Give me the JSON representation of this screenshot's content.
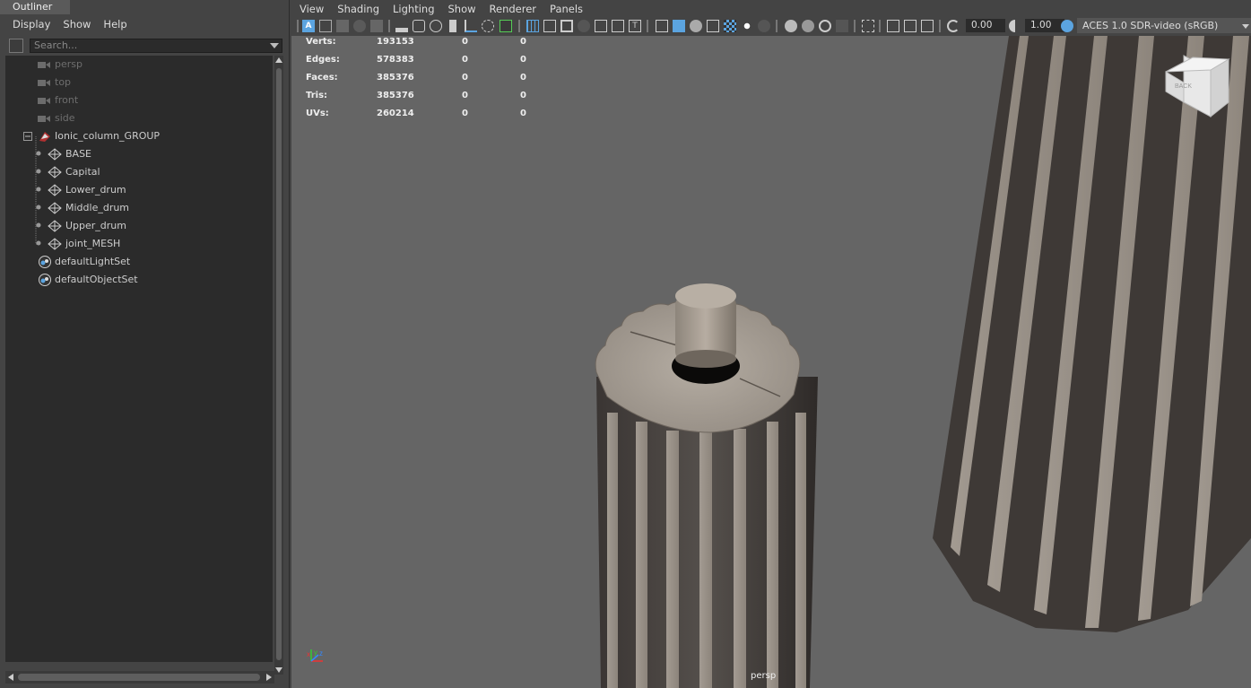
{
  "outliner": {
    "tab_title": "Outliner",
    "menu": [
      "Display",
      "Show",
      "Help"
    ],
    "search_placeholder": "Search...",
    "items": [
      {
        "label": "persp",
        "kind": "camera"
      },
      {
        "label": "top",
        "kind": "camera"
      },
      {
        "label": "front",
        "kind": "camera"
      },
      {
        "label": "side",
        "kind": "camera"
      },
      {
        "label": "Ionic_column_GROUP",
        "kind": "group"
      },
      {
        "label": "BASE",
        "kind": "mesh"
      },
      {
        "label": "Capital",
        "kind": "mesh"
      },
      {
        "label": "Lower_drum",
        "kind": "mesh"
      },
      {
        "label": "Middle_drum",
        "kind": "mesh"
      },
      {
        "label": "Upper_drum",
        "kind": "mesh"
      },
      {
        "label": "joint_MESH",
        "kind": "mesh"
      },
      {
        "label": "defaultLightSet",
        "kind": "set"
      },
      {
        "label": "defaultObjectSet",
        "kind": "set"
      }
    ]
  },
  "viewport": {
    "menu": [
      "View",
      "Shading",
      "Lighting",
      "Show",
      "Renderer",
      "Panels"
    ],
    "exposure_value": "0.00",
    "gamma_value": "1.00",
    "color_space": "ACES 1.0 SDR-video (sRGB)",
    "camera_label": "persp",
    "viewcube_label": "BACK",
    "stats": [
      {
        "label": "Verts:",
        "value": "193153",
        "sel": "0",
        "comp": "0"
      },
      {
        "label": "Edges:",
        "value": "578383",
        "sel": "0",
        "comp": "0"
      },
      {
        "label": "Faces:",
        "value": "385376",
        "sel": "0",
        "comp": "0"
      },
      {
        "label": "Tris:",
        "value": "385376",
        "sel": "0",
        "comp": "0"
      },
      {
        "label": "UVs:",
        "value": "260214",
        "sel": "0",
        "comp": "0"
      }
    ],
    "axis_labels": {
      "x": "x",
      "y": "y",
      "z": "z"
    }
  },
  "colors": {
    "panel_bg": "#444444",
    "list_bg": "#2b2b2b",
    "viewport_bg": "#656565",
    "accent_blue": "#5ba4e0"
  }
}
